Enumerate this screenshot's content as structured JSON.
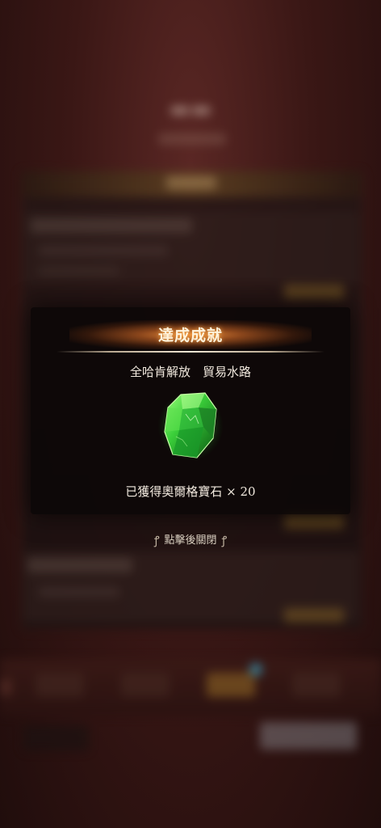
{
  "modal": {
    "title": "達成成就",
    "achievement_name": "全哈肯解放　貿易水路",
    "reward_text": "已獲得奧爾格寶石 × 20",
    "close_hint": "點擊後關閉",
    "reward_icon": "green-gem-icon"
  },
  "colors": {
    "title_glow": "#f0962f",
    "gem_green": "#3fd04a",
    "background_red": "#3a1715"
  }
}
